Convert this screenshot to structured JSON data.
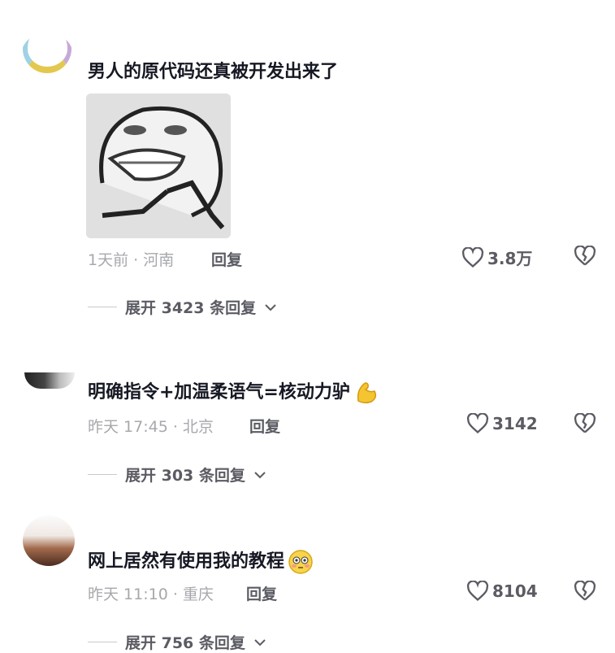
{
  "comments": [
    {
      "text": "男人的原代码还真被开发出来了",
      "time": "1天前 · 河南",
      "reply": "回复",
      "likes": "3.8万",
      "expand": "展开 3423 条回复",
      "has_sticker": true
    },
    {
      "text": "明确指令+加温柔语气=核动力驴",
      "emoji": "flexed-biceps-emoji",
      "time": "昨天 17:45 · 北京",
      "reply": "回复",
      "likes": "3142",
      "expand": "展开 303 条回复"
    },
    {
      "text": "网上居然有使用我的教程",
      "emoji": "flushed-face-emoji",
      "time": "昨天 11:10 · 重庆",
      "reply": "回复",
      "likes": "8104",
      "expand": "展开 756 条回复"
    }
  ],
  "colors": {
    "text": "#161823",
    "meta": "#a7a8ad",
    "action": "#5b5c63"
  }
}
